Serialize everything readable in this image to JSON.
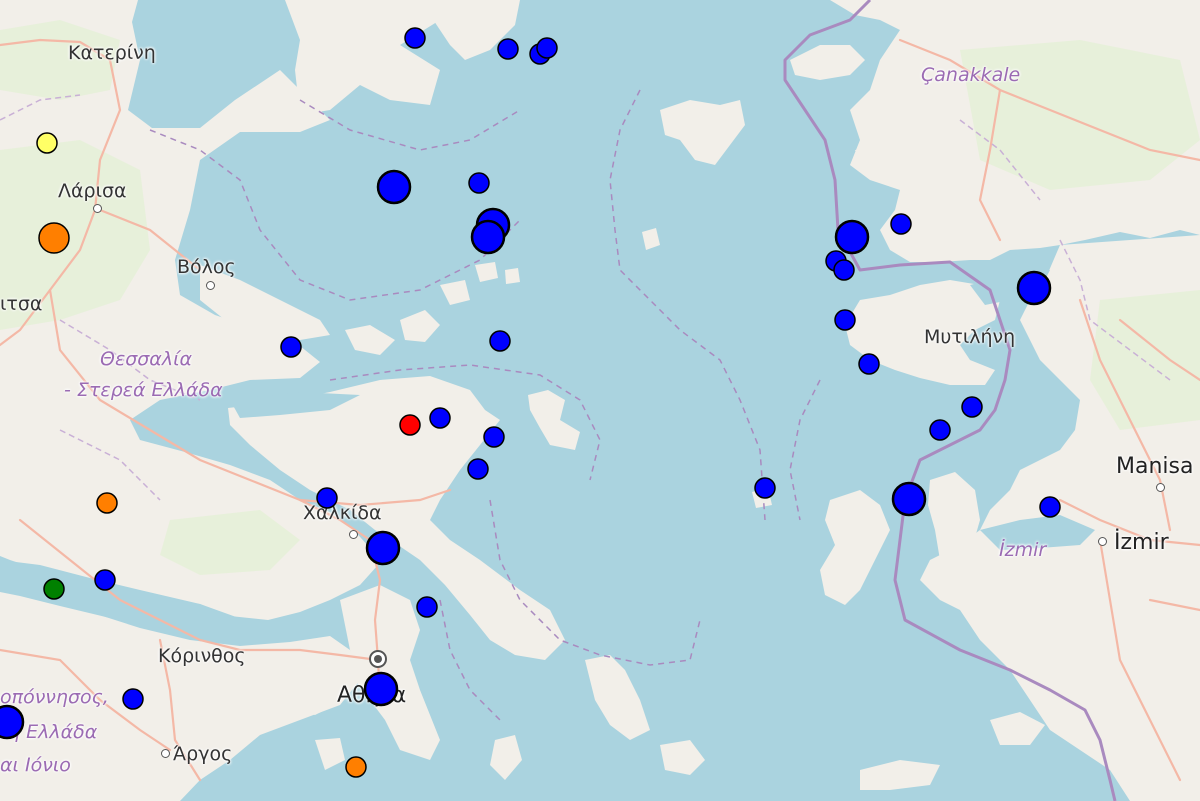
{
  "map": {
    "colors": {
      "sea": "#aad3df",
      "land": "#f2efe9",
      "green_land": "#e6efd8",
      "road": "#f4b8a6",
      "border": "#a98abf",
      "marker_outline": "#000000"
    },
    "labels": {
      "katerini": "Κατερίνη",
      "larisa": "Λάρισα",
      "volos": "Βόλος",
      "tsa": "ιτσα",
      "thessalia": "Θεσσαλία",
      "sterea": "- Στερεά Ελλάδα",
      "chalkida": "Χαλκίδα",
      "korinthos": "Κόρινθος",
      "athina": "Αθήνα",
      "peloponnisos": "οπόννησος,",
      "ellada": "ή Ελλάδα",
      "ionio": "αι Ιόνιο",
      "argos": "Άργος",
      "canakkale": "Çanakkale",
      "mytilini": "Μυτιλήνη",
      "manisa": "Manisa",
      "izmir_region": "İzmir",
      "izmir": "İzmir"
    },
    "markers": [
      {
        "id": "m1",
        "color": "blue",
        "size": "small"
      },
      {
        "id": "m2",
        "color": "blue",
        "size": "small"
      },
      {
        "id": "m3",
        "color": "blue",
        "size": "small"
      },
      {
        "id": "m4",
        "color": "blue",
        "size": "small"
      },
      {
        "id": "m5",
        "color": "yellow",
        "size": "small"
      },
      {
        "id": "m6",
        "color": "blue",
        "size": "large"
      },
      {
        "id": "m7",
        "color": "blue",
        "size": "small"
      },
      {
        "id": "m8",
        "color": "blue",
        "size": "large"
      },
      {
        "id": "m9",
        "color": "blue",
        "size": "large"
      },
      {
        "id": "m10",
        "color": "orange",
        "size": "medium"
      },
      {
        "id": "m11",
        "color": "blue",
        "size": "small"
      },
      {
        "id": "m12",
        "color": "blue",
        "size": "small"
      },
      {
        "id": "m13",
        "color": "blue",
        "size": "large"
      },
      {
        "id": "m14",
        "color": "blue",
        "size": "small"
      },
      {
        "id": "m15",
        "color": "blue",
        "size": "small"
      },
      {
        "id": "m16",
        "color": "blue",
        "size": "small"
      },
      {
        "id": "m17",
        "color": "blue",
        "size": "large"
      },
      {
        "id": "m18",
        "color": "blue",
        "size": "small"
      },
      {
        "id": "m19",
        "color": "blue",
        "size": "small"
      },
      {
        "id": "m20",
        "color": "red",
        "size": "small"
      },
      {
        "id": "m21",
        "color": "blue",
        "size": "small"
      },
      {
        "id": "m22",
        "color": "blue",
        "size": "small"
      },
      {
        "id": "m23",
        "color": "blue",
        "size": "small"
      },
      {
        "id": "m24",
        "color": "blue",
        "size": "small"
      },
      {
        "id": "m25",
        "color": "blue",
        "size": "small"
      },
      {
        "id": "m26",
        "color": "blue",
        "size": "small"
      },
      {
        "id": "m27",
        "color": "blue",
        "size": "large"
      },
      {
        "id": "m28",
        "color": "blue",
        "size": "small"
      },
      {
        "id": "m29",
        "color": "blue",
        "size": "large"
      },
      {
        "id": "m30",
        "color": "orange",
        "size": "small"
      },
      {
        "id": "m31",
        "color": "blue",
        "size": "small"
      },
      {
        "id": "m32",
        "color": "green",
        "size": "small"
      },
      {
        "id": "m33",
        "color": "blue",
        "size": "small"
      },
      {
        "id": "m34",
        "color": "blue",
        "size": "small"
      },
      {
        "id": "m35",
        "color": "blue",
        "size": "small"
      },
      {
        "id": "m36",
        "color": "blue",
        "size": "large"
      },
      {
        "id": "m37",
        "color": "blue",
        "size": "large"
      },
      {
        "id": "m38",
        "color": "orange",
        "size": "small"
      }
    ]
  }
}
